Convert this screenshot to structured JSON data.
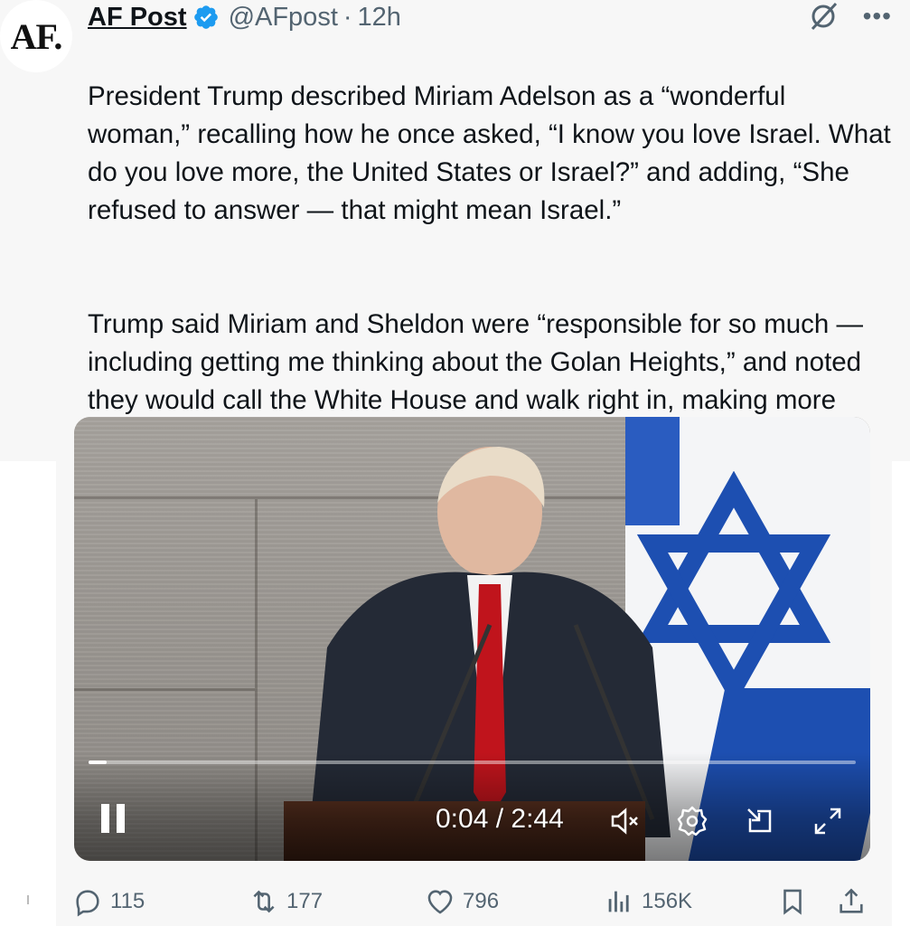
{
  "tweet": {
    "author": {
      "avatar_text": "AF.",
      "display_name": "AF Post",
      "handle": "@AFpost",
      "time": "12h",
      "verified": true
    },
    "paragraphs": [
      "President Trump described Miriam Adelson as a “wonderful woman,” recalling how he once asked, “I know you love Israel. What do you love more, the United States or Israel?” and adding, “She refused to answer — that might mean Israel.”",
      "Trump said Miriam and Sheldon were “responsible for so much — including getting me thinking about the Golan Heights,” and noted they would call the White House and walk right in, making more visits than anyone else."
    ],
    "header_icons": [
      "grok-icon",
      "more-icon"
    ]
  },
  "video": {
    "current_time": "0:04",
    "duration": "2:44",
    "time_readout": "0:04 / 2:44",
    "progress_fraction": 0.024,
    "state": "playing",
    "controls": [
      "pause-icon",
      "mute-icon",
      "settings-icon",
      "pip-icon",
      "fullscreen-icon"
    ]
  },
  "actions": {
    "replies": "115",
    "reposts": "177",
    "likes": "796",
    "views": "156K",
    "icons": [
      "reply-icon",
      "repost-icon",
      "like-icon",
      "views-icon",
      "bookmark-icon",
      "share-icon"
    ]
  },
  "colors": {
    "verified_blue": "#1d9bf0",
    "text_primary": "#0f1419",
    "text_secondary": "#536471",
    "flag_blue": "#1d4fb1"
  }
}
